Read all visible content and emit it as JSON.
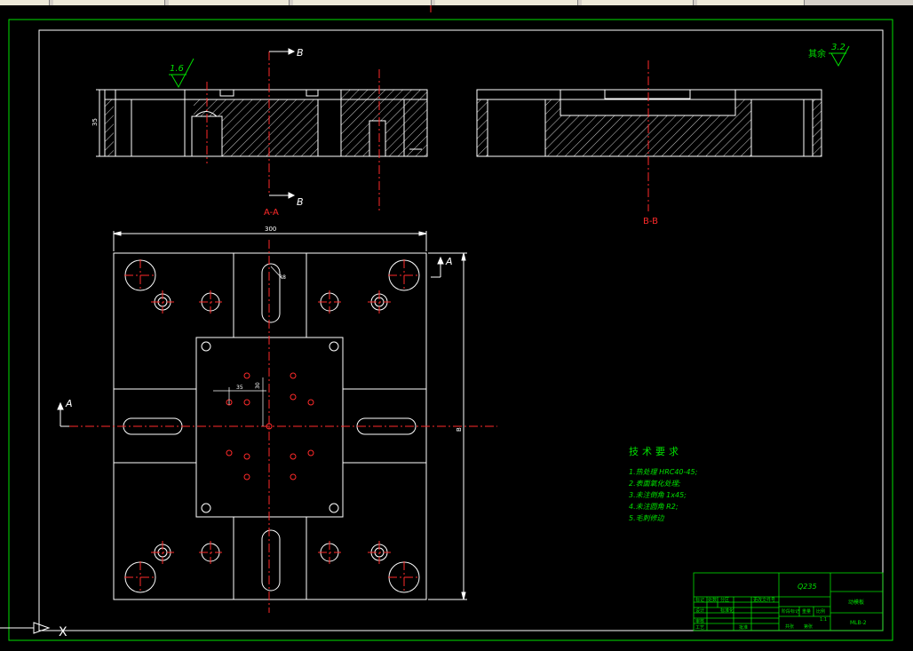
{
  "drawing": {
    "section_aa_label": "A-A",
    "section_bb_label": "B-B",
    "cut_label_b_top": "B",
    "cut_label_b_bottom": "B",
    "cut_label_a_right": "A",
    "cut_label_a_left": "A",
    "roughness_local": "1.6",
    "roughness_global": "3.2",
    "roughness_rest_label": "其余",
    "dim_width": "300",
    "dim_height": "B",
    "dim_depth": "35",
    "dim_r": "R8",
    "dim_small_1": "35",
    "dim_small_2": "30"
  },
  "tech_requirements": {
    "title": "技术要求",
    "items": [
      "1.热处理 HRC40-45;",
      "2.表面氧化处理;",
      "3.未注倒角 1x45;",
      "4.未注圆角 R2;",
      "5.毛刺修边"
    ]
  },
  "title_block": {
    "material": "Q235",
    "part_name": "动模板",
    "scale": "1:1",
    "labels": [
      "标记",
      "处数",
      "分区",
      "更改文件号",
      "签名",
      "年月日",
      "设计",
      "标准化",
      "审核",
      "工艺",
      "批准"
    ],
    "cells": [
      "阶段标记",
      "重量",
      "比例",
      "共张",
      "第张"
    ],
    "drawing_no": "MLB-2"
  },
  "colors": {
    "white": "#ffffff",
    "red": "#ff2a2a",
    "green": "#00e000",
    "bg": "#000000"
  },
  "ucs": {
    "x_label": "X"
  }
}
